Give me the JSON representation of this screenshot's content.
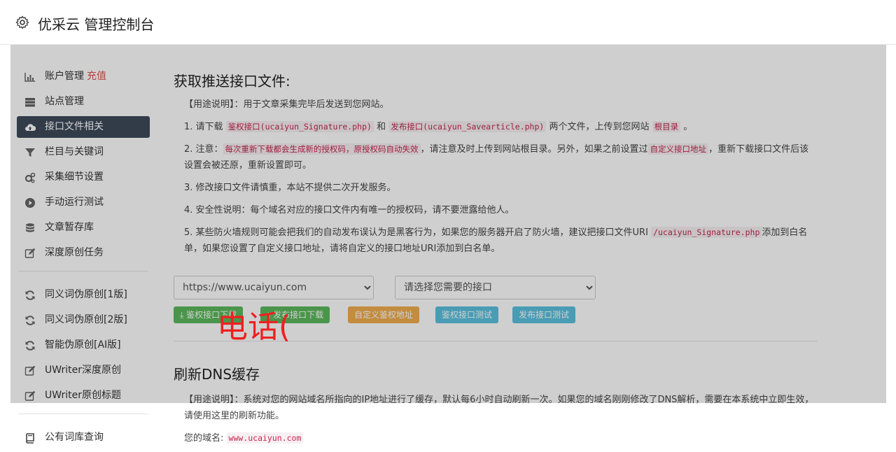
{
  "header": {
    "icon": "gear-icon",
    "title": "优采云 管理控制台"
  },
  "sidebar": {
    "items": [
      {
        "label": "账户管理",
        "badge": "充值",
        "icon": "bar-chart-icon",
        "active": false
      },
      {
        "label": "站点管理",
        "icon": "server-icon",
        "active": false
      },
      {
        "label": "接口文件相关",
        "icon": "cloud-upload-icon",
        "active": true
      },
      {
        "label": "栏目与关键词",
        "icon": "filter-icon",
        "active": false
      },
      {
        "label": "采集细节设置",
        "icon": "cogs-icon",
        "active": false
      },
      {
        "label": "手动运行测试",
        "icon": "play-circle-icon",
        "active": false
      },
      {
        "label": "文章暂存库",
        "icon": "database-icon",
        "active": false
      },
      {
        "label": "深度原创任务",
        "icon": "edit-icon",
        "active": false
      }
    ],
    "items2": [
      {
        "label": "同义词伪原创[1版]",
        "icon": "refresh-icon"
      },
      {
        "label": "同义词伪原创[2版]",
        "icon": "refresh-icon"
      },
      {
        "label": "智能伪原创[AI版]",
        "icon": "refresh-icon"
      },
      {
        "label": "UWriter深度原创",
        "icon": "edit-icon"
      },
      {
        "label": "UWriter原创标题",
        "icon": "edit-icon"
      }
    ],
    "items3": [
      {
        "label": "公有词库查询",
        "icon": "book-icon"
      }
    ]
  },
  "main": {
    "section1": {
      "title": "获取推送接口文件:",
      "usage": "【用途说明】：用于文章采集完毕后发送到您网站。",
      "step1": {
        "pre": "1. 请下载",
        "code1": "鉴权接口(ucaiyun_Signature.php)",
        "mid": "和",
        "code2": "发布接口(ucaiyun_Savearticle.php)",
        "post": "两个文件，上传到您网站",
        "code3": "根目录",
        "end": "。"
      },
      "step2": {
        "pre": "2. 注意：",
        "code1": "每次重新下载都会生成新的授权码，原授权码自动失效",
        "mid": "，请注意及时上传到网站根目录。另外，如果之前设置过",
        "code2": "自定义接口地址",
        "post": "，重新下载接口文件后该设置会被还原，重新设置即可。"
      },
      "step3": "3. 修改接口文件请慎重，本站不提供二次开发服务。",
      "step4": "4. 安全性说明：每个域名对应的接口文件内有唯一的授权码，请不要泄露给他人。",
      "step5": {
        "pre": "5. 某些防火墙规则可能会把我们的自动发布误认为是黑客行为，如果您的服务器开启了防火墙，建议把接口文件URI",
        "code1": "/ucaiyun_Signature.php",
        "post": "添加到白名单，如果您设置了自定义接口地址，请将自定义的接口地址URI添加到白名单。"
      },
      "site_select": "https://www.ucaiyun.com",
      "api_select": "请选择您需要的接口",
      "buttons": {
        "dl_auth": "鉴权接口下载",
        "dl_pub": "发布接口下载",
        "custom_auth": "自定义鉴权地址",
        "test_auth": "鉴权接口测试",
        "test_pub": "发布接口测试"
      }
    },
    "section2": {
      "title": "刷新DNS缓存",
      "usage": "【用途说明】：系统对您的网站域名所指向的IP地址进行了缓存，默认每6小时自动刷新一次。如果您的域名刚刚修改了DNS解析，需要在本系统中立即生效，请使用这里的刷新功能。",
      "domain_label": "您的域名:",
      "domain_value": "www.ucaiyun.com"
    }
  },
  "overlay_text": "电话(",
  "colors": {
    "active_nav": "#3e4a5b",
    "code_text": "#c7254e",
    "btn_green": "#5cb85c",
    "btn_orange": "#f0ad4e",
    "btn_blue": "#5bc0de",
    "overlay_red": "#ee2020",
    "badge_red": "#d9534f"
  }
}
